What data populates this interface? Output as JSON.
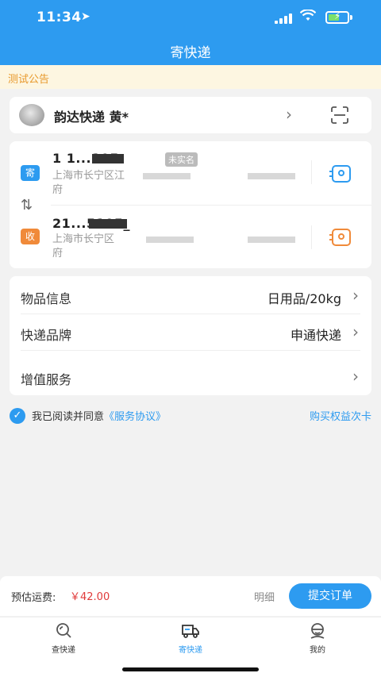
{
  "status_bar": {
    "time": "11:34"
  },
  "nav": {
    "title": "寄快递"
  },
  "notice": {
    "text": "测试公告"
  },
  "courier": {
    "name": "韵达快递 黄*"
  },
  "sender": {
    "tag": "寄",
    "phone": "1 1...105",
    "realname_badge": "未实名",
    "address_line1": "上海市长宁区江",
    "address_line2": "府"
  },
  "receiver": {
    "tag": "收",
    "phone": "21...5105_",
    "address_line1": "上海市长宁区",
    "address_line2": "府"
  },
  "info": {
    "rows": [
      {
        "label": "物品信息",
        "value": "日用品/20kg"
      },
      {
        "label": "快递品牌",
        "value": "申通快递"
      },
      {
        "label": "增值服务",
        "value": ""
      }
    ]
  },
  "agreement": {
    "prefix": "我已阅读并同意",
    "link": "《服务协议》",
    "buy_card": "购买权益次卡"
  },
  "footer": {
    "fee_label": "预估运费:",
    "fee_value": "￥42.00",
    "detail": "明细",
    "submit": "提交订单"
  },
  "tabs": [
    {
      "label": "查快递",
      "icon": "search-icon",
      "active": false
    },
    {
      "label": "寄快递",
      "icon": "truck-icon",
      "active": true
    },
    {
      "label": "我的",
      "icon": "profile-icon",
      "active": false
    }
  ],
  "colors": {
    "primary": "#2d9bf0",
    "send_tag": "#2d9bf0",
    "recv_tag": "#f08a3a",
    "notice_text": "#e8992c",
    "price": "#e03a3a"
  }
}
